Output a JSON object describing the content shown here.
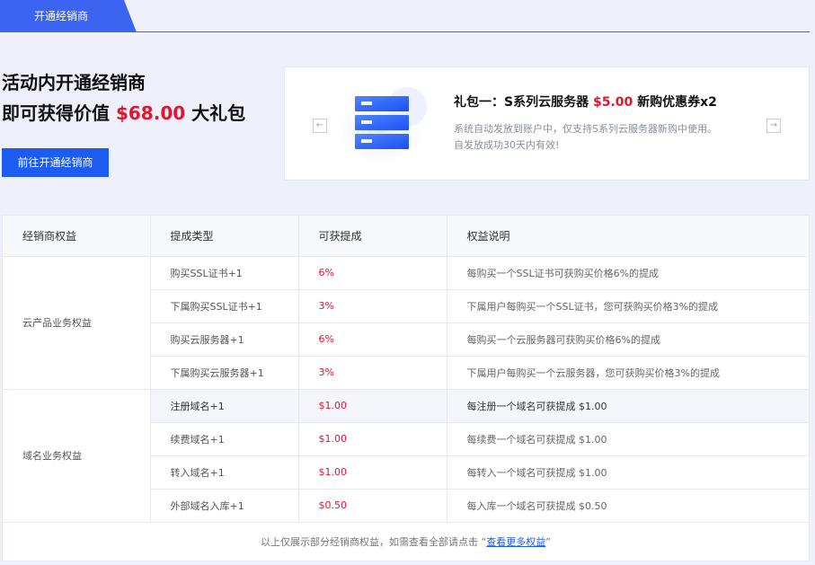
{
  "tab": {
    "label": "开通经销商"
  },
  "promo": {
    "line1": "活动内开通经销商",
    "line2_prefix": "即可获得价值 ",
    "line2_price": "$68.00",
    "line2_suffix": " 大礼包",
    "cta_label": "前往开通经销商"
  },
  "gift": {
    "title_prefix": "礼包一：S系列云服务器 ",
    "title_price": "$5.00",
    "title_suffix": " 新购优惠券x2",
    "desc_line1": "系统自动发放到账户中，仅支持S系列云服务器新购中使用。",
    "desc_line2": "自发放成功30天内有效!",
    "prev_icon": "←",
    "next_icon": "→"
  },
  "table": {
    "headers": [
      "经销商权益",
      "提成类型",
      "可获提成",
      "权益说明"
    ],
    "groups": [
      {
        "name": "云产品业务权益",
        "rows": [
          {
            "type": "购买SSL证书+1",
            "rate": "6%",
            "desc": "每购买一个SSL证书可获购买价格6%的提成"
          },
          {
            "type": "下属购买SSL证书+1",
            "rate": "3%",
            "desc": "下属用户每购买一个SSL证书，您可获购买价格3%的提成"
          },
          {
            "type": "购买云服务器+1",
            "rate": "6%",
            "desc": "每购买一个云服务器可获购买价格6%的提成"
          },
          {
            "type": "下属购买云服务器+1",
            "rate": "3%",
            "desc": "下属用户每购买一个云服务器，您可获购买价格3%的提成"
          }
        ]
      },
      {
        "name": "域名业务权益",
        "rows": [
          {
            "type": "注册域名+1",
            "rate": "$1.00",
            "desc": "每注册一个域名可获提成 $1.00"
          },
          {
            "type": "续费域名+1",
            "rate": "$1.00",
            "desc": "每续费一个域名可获提成 $1.00"
          },
          {
            "type": "转入域名+1",
            "rate": "$1.00",
            "desc": "每转入一个域名可获提成 $1.00"
          },
          {
            "type": "外部域名入库+1",
            "rate": "$0.50",
            "desc": "每入库一个域名可获提成 $0.50"
          }
        ]
      }
    ],
    "footer_prefix": "以上仅展示部分经销商权益，如需查看全部请点击 “",
    "footer_link": "查看更多权益",
    "footer_suffix": "”"
  },
  "colors": {
    "accent": "#1e5bf0",
    "price": "#e8132a",
    "background": "#eef1fc"
  }
}
